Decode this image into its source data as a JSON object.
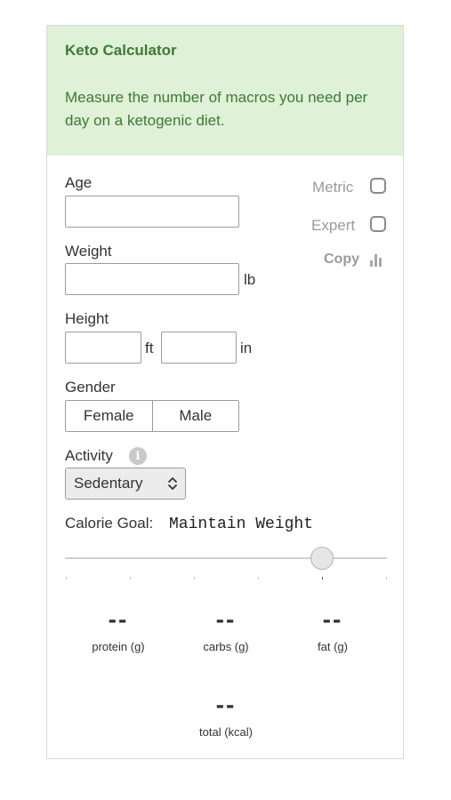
{
  "header": {
    "title": "Keto Calculator",
    "subtitle": "Measure the number of macros you need per day on a ketogenic diet."
  },
  "form": {
    "age_label": "Age",
    "age_value": "",
    "weight_label": "Weight",
    "weight_value": "",
    "weight_unit": "lb",
    "height_label": "Height",
    "height_ft_value": "",
    "height_ft_unit": "ft",
    "height_in_value": "",
    "height_in_unit": "in",
    "gender_label": "Gender",
    "gender_options": [
      "Female",
      "Male"
    ],
    "activity_label": "Activity",
    "activity_info_icon": "info-icon",
    "activity_selected": "Sedentary",
    "calorie_goal_label": "Calorie Goal:",
    "calorie_goal_value": "Maintain Weight",
    "calorie_goal_slider_index": 4,
    "calorie_goal_slider_steps": 6
  },
  "options": {
    "metric_label": "Metric",
    "metric_checked": false,
    "expert_label": "Expert",
    "expert_checked": false,
    "copy_label": "Copy",
    "copy_icon": "bar-chart-icon"
  },
  "results": {
    "protein_value": "--",
    "protein_label": "protein (g)",
    "carbs_value": "--",
    "carbs_label": "carbs (g)",
    "fat_value": "--",
    "fat_label": "fat (g)",
    "total_value": "--",
    "total_label": "total (kcal)"
  },
  "colors": {
    "header_bg": "#dff1d6",
    "header_text": "#3c7a37"
  }
}
